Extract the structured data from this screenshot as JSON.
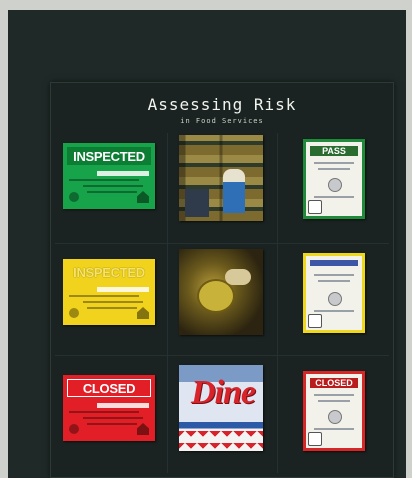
{
  "poster": {
    "title": "Assessing Risk",
    "subtitle": "in Food Services"
  },
  "placards": {
    "green": "INSPECTED",
    "yellow": "INSPECTED",
    "red": "CLOSED"
  },
  "certificates": {
    "green": "PASS",
    "yellow": "",
    "red": "CLOSED"
  },
  "photos": {
    "bottom_sign": "Dine"
  },
  "colors": {
    "background": "#cfd2cc",
    "frame": "#1f2a28",
    "poster": "#1a2321",
    "pass_green": "#16a34a",
    "conditional_yellow": "#f1d21c",
    "closed_red": "#e21f26"
  }
}
